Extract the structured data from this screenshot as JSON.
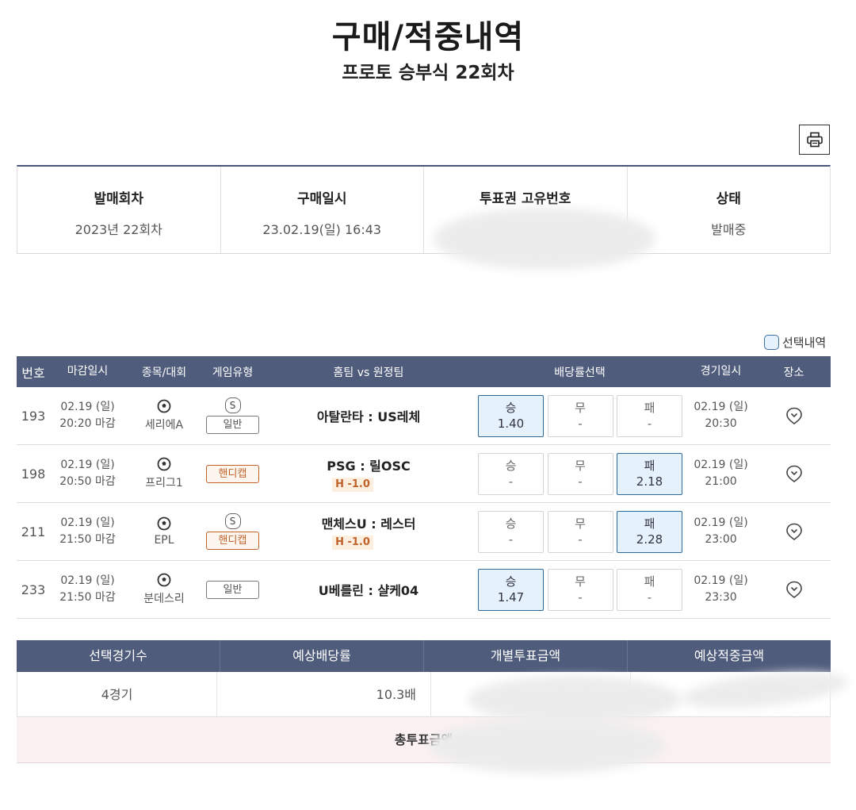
{
  "header": {
    "title": "구매/적중내역",
    "subtitle": "프로토 승부식 22회차"
  },
  "info": {
    "round_label": "발매회차",
    "round_value": "2023년 22회차",
    "purchase_label": "구매일시",
    "purchase_value": "23.02.19(일) 16:43",
    "ticket_label": "투표권 고유번호",
    "status_label": "상태",
    "status_value": "발매중"
  },
  "legend": {
    "label": "선택내역"
  },
  "table": {
    "headers": [
      "번호",
      "마감일시",
      "종목/대회",
      "게임유형",
      "홈팀 vs 원정팀",
      "배당률선택",
      "경기일시",
      "장소"
    ],
    "rows": [
      {
        "num": "193",
        "deadline_date": "02.19 (일)",
        "deadline_time": "20:20 마감",
        "league": "세리에A",
        "s_badge": "S",
        "type": "일반",
        "teams": "아탈란타 : US레체",
        "handicap": "",
        "odds": [
          {
            "label": "승",
            "value": "1.40",
            "selected": true
          },
          {
            "label": "무",
            "value": "-",
            "selected": false
          },
          {
            "label": "패",
            "value": "-",
            "selected": false
          }
        ],
        "match_date": "02.19 (일)",
        "match_time": "20:30"
      },
      {
        "num": "198",
        "deadline_date": "02.19 (일)",
        "deadline_time": "20:50 마감",
        "league": "프리그1",
        "s_badge": "",
        "type": "핸디캡",
        "teams": "PSG : 릴OSC",
        "handicap": "H -1.0",
        "odds": [
          {
            "label": "승",
            "value": "-",
            "selected": false
          },
          {
            "label": "무",
            "value": "-",
            "selected": false
          },
          {
            "label": "패",
            "value": "2.18",
            "selected": true
          }
        ],
        "match_date": "02.19 (일)",
        "match_time": "21:00"
      },
      {
        "num": "211",
        "deadline_date": "02.19 (일)",
        "deadline_time": "21:50 마감",
        "league": "EPL",
        "s_badge": "S",
        "type": "핸디캡",
        "teams": "맨체스U : 레스터",
        "handicap": "H -1.0",
        "odds": [
          {
            "label": "승",
            "value": "-",
            "selected": false
          },
          {
            "label": "무",
            "value": "-",
            "selected": false
          },
          {
            "label": "패",
            "value": "2.28",
            "selected": true
          }
        ],
        "match_date": "02.19 (일)",
        "match_time": "23:00"
      },
      {
        "num": "233",
        "deadline_date": "02.19 (일)",
        "deadline_time": "21:50 마감",
        "league": "분데스리",
        "s_badge": "",
        "type": "일반",
        "teams": "U베를린 : 샬케04",
        "handicap": "",
        "odds": [
          {
            "label": "승",
            "value": "1.47",
            "selected": true
          },
          {
            "label": "무",
            "value": "-",
            "selected": false
          },
          {
            "label": "패",
            "value": "-",
            "selected": false
          }
        ],
        "match_date": "02.19 (일)",
        "match_time": "23:30"
      }
    ]
  },
  "summary": {
    "headers": [
      "선택경기수",
      "예상배당률",
      "개별투표금액",
      "예상적중금액"
    ],
    "games": "4경기",
    "odds": "10.3배",
    "total_label": "총투표금액"
  }
}
